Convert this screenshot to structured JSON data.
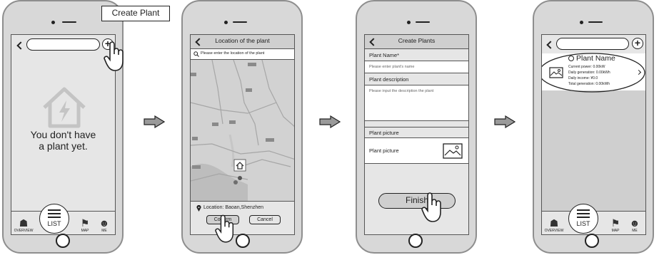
{
  "callout": {
    "text": "Create Plant"
  },
  "steps": [
    {
      "empty_message": "You don't have a plant yet.",
      "tabs": {
        "overview": "OVERVIEW",
        "list": "LIST",
        "map": "MAP",
        "me": "ME"
      }
    },
    {
      "header_title": "Location of the plant",
      "search_placeholder": "Please enter the location of the plant",
      "location_label": "Location: Baoan,Shenzhen",
      "confirm_label": "Confirm",
      "cancel_label": "Cancel"
    },
    {
      "header_title": "Create Plants",
      "plant_name_label": "Plant Name*",
      "plant_name_placeholder": "Please enter plant's name",
      "description_label": "Plant description",
      "description_placeholder": "Please input the description the plant",
      "picture_section_label": "Plant picture",
      "picture_label": "Plant picture",
      "finish_label": "Finish"
    },
    {
      "plant_card": {
        "name": "Plant Name",
        "current_power": "Current power: 0.00kW",
        "daily_generation": "Daily generation: 0.00kWh",
        "daily_income": "Daily income: ¥0.0",
        "total_generation": "Total generation: 0.00kWh"
      },
      "tabs": {
        "overview": "OVERVIEW",
        "list": "LIST",
        "map": "MAP",
        "me": "ME"
      }
    }
  ],
  "colors": {
    "frame": "#8e8e8e",
    "screen": "#e6e6e6",
    "header": "#cfcfcf",
    "map_water": "#bdbdbd"
  }
}
